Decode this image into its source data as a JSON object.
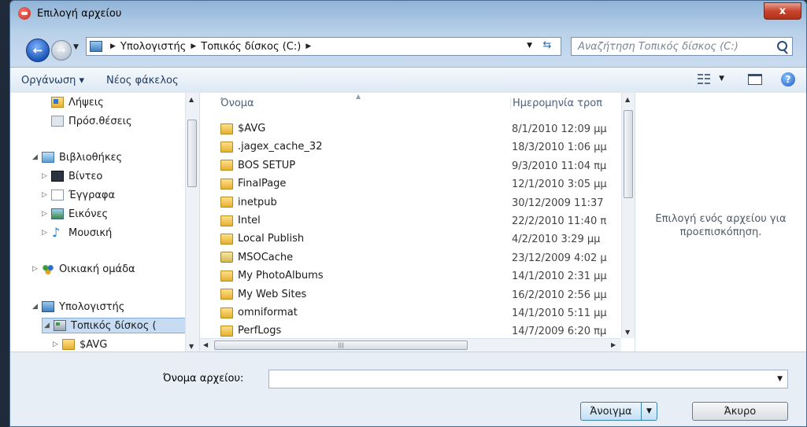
{
  "window": {
    "title": "Επιλογή αρχείου",
    "close_label": "x"
  },
  "nav": {
    "breadcrumb": [
      "Υπολογιστής",
      "Τοπικός δίσκος (C:)"
    ],
    "search_placeholder": "Αναζήτηση Τοπικός δίσκος (C:)"
  },
  "toolbar": {
    "organize_label": "Οργάνωση ▾",
    "new_folder_label": "Νέος φάκελος"
  },
  "sidebar": {
    "items": [
      {
        "label": "Λήψεις",
        "icon": "downloads-icon"
      },
      {
        "label": "Πρόσ.θέσεις",
        "icon": "recent-places-icon"
      },
      {
        "label": "Βιβλιοθήκες",
        "icon": "libraries-icon"
      },
      {
        "label": "Βίντεο",
        "icon": "video-icon"
      },
      {
        "label": "Έγγραφα",
        "icon": "documents-icon"
      },
      {
        "label": "Εικόνες",
        "icon": "pictures-icon"
      },
      {
        "label": "Μουσική",
        "icon": "music-icon"
      },
      {
        "label": "Οικιακή ομάδα",
        "icon": "homegroup-icon"
      },
      {
        "label": "Υπολογιστής",
        "icon": "computer-icon"
      },
      {
        "label": "Τοπικός δίσκος (",
        "icon": "local-disk-icon"
      },
      {
        "label": "$AVG",
        "icon": "folder-icon"
      }
    ]
  },
  "files": {
    "columns": [
      "Όνομα",
      "Ημερομηνία τροπ"
    ],
    "rows": [
      {
        "name": "$AVG",
        "date": "8/1/2010 12:09 μμ"
      },
      {
        "name": ".jagex_cache_32",
        "date": "18/3/2010 1:06 μμ"
      },
      {
        "name": "BOS SETUP",
        "date": "9/3/2010 11:04 πμ"
      },
      {
        "name": "FinalPage",
        "date": "12/1/2010 3:05 μμ"
      },
      {
        "name": "inetpub",
        "date": "30/12/2009 11:37"
      },
      {
        "name": "Intel",
        "date": "22/2/2010 11:40 π"
      },
      {
        "name": "Local Publish",
        "date": "4/2/2010 3:29 μμ"
      },
      {
        "name": "MSOCache",
        "date": "23/12/2009 4:02 μ"
      },
      {
        "name": "My PhotoAlbums",
        "date": "14/1/2010 2:31 μμ"
      },
      {
        "name": "My Web Sites",
        "date": "16/2/2010 2:56 μμ"
      },
      {
        "name": "omniformat",
        "date": "14/1/2010 5:11 μμ"
      },
      {
        "name": "PerfLogs",
        "date": "14/7/2009 6:20 πμ"
      }
    ]
  },
  "preview": {
    "line1": "Επιλογή ενός αρχείου για",
    "line2": "προεπισκόπηση."
  },
  "bottom": {
    "filename_label": "Όνομα αρχείου:",
    "filename_value": "",
    "open_label": "Άνοιγμα",
    "cancel_label": "Άκυρο"
  }
}
